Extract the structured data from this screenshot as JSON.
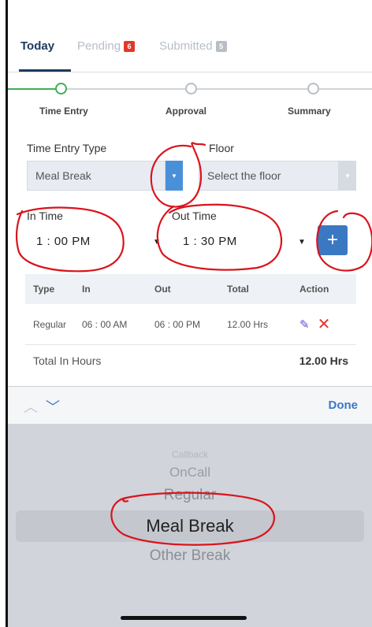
{
  "tabs": [
    {
      "label": "Today"
    },
    {
      "label": "Pending",
      "count": "6"
    },
    {
      "label": "Submitted",
      "count": "5"
    }
  ],
  "stepper": {
    "steps": [
      {
        "label": "Time Entry"
      },
      {
        "label": "Approval"
      },
      {
        "label": "Summary"
      }
    ]
  },
  "form": {
    "time_entry_type_label": "Time Entry Type",
    "time_entry_type_value": "Meal Break",
    "floor_label": "Floor",
    "floor_placeholder": "Select the floor",
    "in_time_label": "In Time",
    "in_time_value": "1 : 00  PM",
    "out_time_label": "Out Time",
    "out_time_value": "1 : 30  PM",
    "add_label": "+"
  },
  "table": {
    "headers": [
      "Type",
      "In",
      "Out",
      "Total",
      "Action"
    ],
    "rows": [
      {
        "type": "Regular",
        "in": "06 : 00 AM",
        "out": "06 : 00 PM",
        "total": "12.00 Hrs"
      }
    ],
    "total_label": "Total In Hours",
    "total_value": "12.00 Hrs"
  },
  "picker": {
    "done_label": "Done",
    "options": [
      "Callback",
      "OnCall",
      "Regular",
      "Meal Break",
      "Other Break"
    ],
    "selected": "Meal Break"
  },
  "colors": {
    "accent": "#3b78c2",
    "navy": "#1e3a5f",
    "step_green": "#3fae5a",
    "badge_red": "#e2382b",
    "annotation_red": "#d9141c"
  }
}
